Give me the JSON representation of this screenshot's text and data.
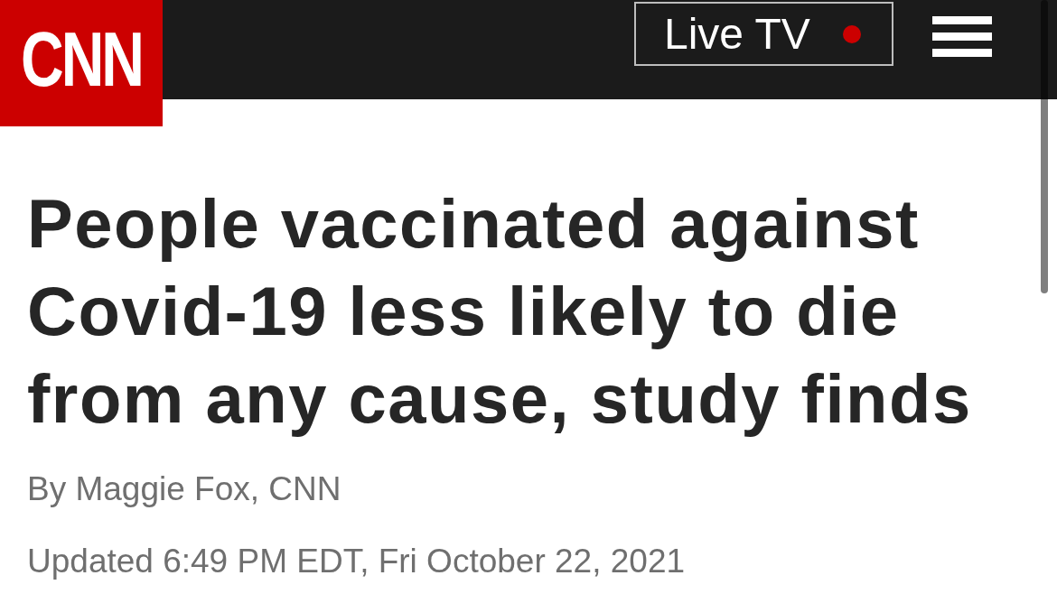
{
  "header": {
    "logo": "CNN",
    "live_tv": {
      "label": "Live TV"
    }
  },
  "article": {
    "headline": "People vaccinated against Covid-19 less likely to die from any cause, study finds",
    "byline": "By Maggie Fox, CNN",
    "timestamp": "Updated 6:49 PM EDT, Fri October 22, 2021"
  }
}
